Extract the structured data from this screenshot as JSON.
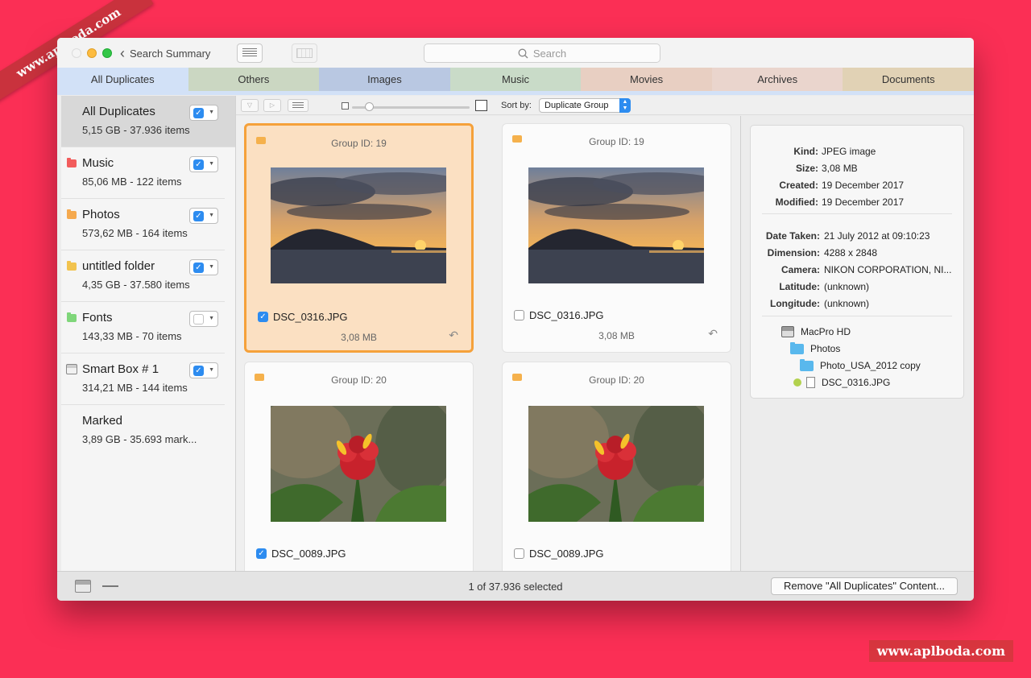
{
  "watermark": {
    "top": "www.aplboda.com",
    "bottom": "www.aplboda.com"
  },
  "titlebar": {
    "back_label": "Search Summary",
    "search_placeholder": "Search"
  },
  "tabs": [
    {
      "label": "All Duplicates",
      "color": "#d2e1f7"
    },
    {
      "label": "Others",
      "color": "#cbd7c2"
    },
    {
      "label": "Images",
      "color": "#b9c8e2"
    },
    {
      "label": "Music",
      "color": "#c9dbc8"
    },
    {
      "label": "Movies",
      "color": "#e8cfc2"
    },
    {
      "label": "Archives",
      "color": "#ead5cd"
    },
    {
      "label": "Documents",
      "color": "#e1d2b5"
    }
  ],
  "sidebar": {
    "items": [
      {
        "name": "All Duplicates",
        "sub": "5,15 GB - 37.936 items",
        "checked": true
      },
      {
        "name": "Music",
        "sub": "85,06 MB - 122 items",
        "checked": true,
        "folder_color": "#f25c5c"
      },
      {
        "name": "Photos",
        "sub": "573,62 MB - 164 items",
        "checked": true,
        "folder_color": "#f5a94e"
      },
      {
        "name": "untitled folder",
        "sub": "4,35 GB - 37.580 items",
        "checked": true,
        "folder_color": "#f2c34e"
      },
      {
        "name": "Fonts",
        "sub": "143,33 MB - 70 items",
        "checked": false,
        "folder_color": "#7fd67a"
      },
      {
        "name": "Smart Box # 1",
        "sub": "314,21 MB - 144 items",
        "checked": true
      },
      {
        "name": "Marked",
        "sub": "3,89 GB - 35.693 mark..."
      }
    ]
  },
  "toolbar": {
    "sort_label": "Sort by:",
    "sort_value": "Duplicate Group"
  },
  "cards": [
    {
      "group": "Group ID: 19",
      "file": "DSC_0316.JPG",
      "size": "3,08 MB",
      "checked": true
    },
    {
      "group": "Group ID: 19",
      "file": "DSC_0316.JPG",
      "size": "3,08 MB",
      "checked": false
    },
    {
      "group": "Group ID: 20",
      "file": "DSC_0089.JPG",
      "checked": true
    },
    {
      "group": "Group ID: 20",
      "file": "DSC_0089.JPG",
      "checked": false
    }
  ],
  "inspector": {
    "kind": {
      "k": "Kind:",
      "v": "JPEG image"
    },
    "size": {
      "k": "Size:",
      "v": "3,08 MB"
    },
    "created": {
      "k": "Created:",
      "v": "19 December 2017"
    },
    "modified": {
      "k": "Modified:",
      "v": "19 December 2017"
    },
    "date_taken": {
      "k": "Date Taken:",
      "v": "21 July 2012 at 09:10:23"
    },
    "dimension": {
      "k": "Dimension:",
      "v": "4288 x 2848"
    },
    "camera": {
      "k": "Camera:",
      "v": "NIKON CORPORATION, NI..."
    },
    "latitude": {
      "k": "Latitude:",
      "v": "(unknown)"
    },
    "longitude": {
      "k": "Longitude:",
      "v": "(unknown)"
    },
    "path": {
      "disk": "MacPro HD",
      "folder": "Photos",
      "subfolder": "Photo_USA_2012 copy",
      "file": "DSC_0316.JPG"
    }
  },
  "statusbar": {
    "status": "1 of 37.936 selected",
    "remove_label": "Remove \"All Duplicates\" Content..."
  }
}
